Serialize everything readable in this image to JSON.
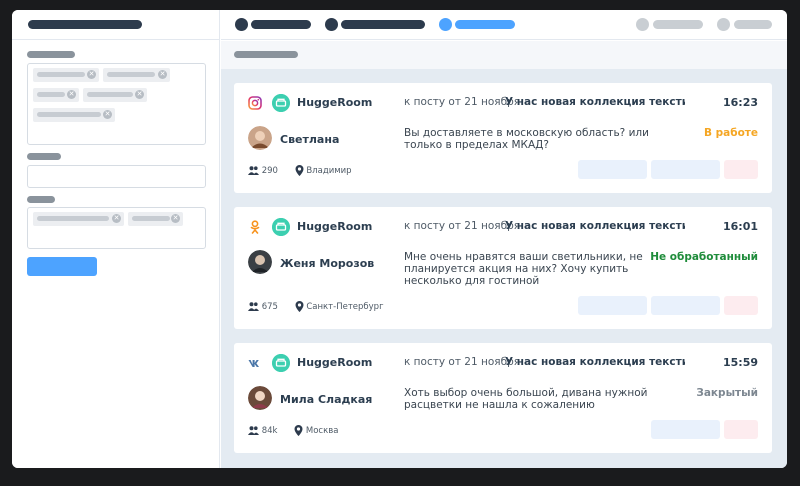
{
  "colors": {
    "accent": "#4da3ff",
    "dark": "#2d3b4d",
    "brand": "#3ccfb0",
    "status_in_progress": "#f5a623",
    "status_new": "#1e8c3a",
    "status_closed": "#7d8791"
  },
  "conversations": [
    {
      "source_icon": "instagram-icon",
      "brand": "HuggeRoom",
      "post_ref": "к посту от 21 ноября",
      "post_title": "У нас новая коллекция текстиля...",
      "time": "16:23",
      "user_name": "Светлана",
      "message": "Вы доставляете в московскую область? или только в пределах МКАД?",
      "status": "В работе",
      "followers": "290",
      "location": "Владимир"
    },
    {
      "source_icon": "odnoklassniki-icon",
      "brand": "HuggeRoom",
      "post_ref": "к посту от 21 ноября",
      "post_title": "У нас новая коллекция текстиля...",
      "time": "16:01",
      "user_name": "Женя Морозов",
      "message": "Мне очень нравятся ваши светильники, не планируется акция на них? Хочу купить несколько для гостиной",
      "status": "Не обработанный",
      "followers": "675",
      "location": "Санкт-Петербург"
    },
    {
      "source_icon": "vk-icon",
      "brand": "HuggeRoom",
      "post_ref": "к посту от 21 ноября",
      "post_title": "У нас новая коллекция текстиля...",
      "time": "15:59",
      "user_name": "Мила Сладкая",
      "message": "Хоть выбор очень большой, дивана нужной расцветки не нашла к сожалению",
      "status": "Закрытый",
      "followers": "84k",
      "location": "Москва"
    }
  ]
}
